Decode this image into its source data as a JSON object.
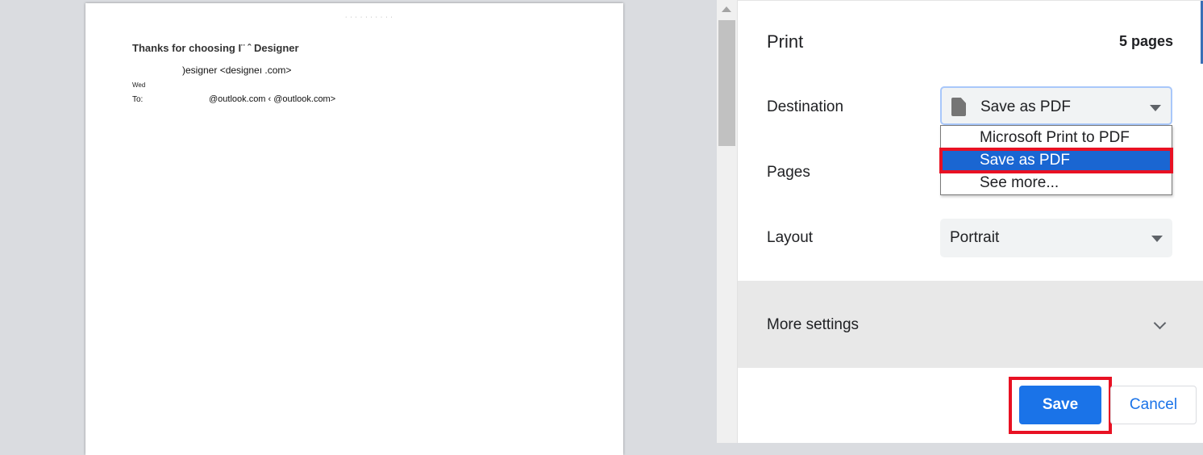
{
  "preview": {
    "header_faint": "· · ·  · ·    · · · · ·",
    "subject": "Thanks for choosing I¨        ˆ  Designer",
    "from": ")esigner <designeı                              .com>",
    "date": "Wed",
    "to_label": "To:",
    "to_value": "@outlook.com ‹                   @outlook.com>"
  },
  "print": {
    "title": "Print",
    "pages_count": "5 pages",
    "destination": {
      "label": "Destination",
      "value": "Save as PDF",
      "icon": "file-icon",
      "options": [
        "Microsoft Print to PDF",
        "Save as PDF",
        "See more..."
      ],
      "selected_index": 1
    },
    "pages": {
      "label": "Pages"
    },
    "layout": {
      "label": "Layout",
      "value": "Portrait"
    },
    "more_settings": {
      "label": "More settings"
    },
    "actions": {
      "save": "Save",
      "cancel": "Cancel"
    }
  },
  "colors": {
    "accent": "#1a73e8",
    "selected_option": "#1a66d2",
    "highlight": "#e81123"
  }
}
